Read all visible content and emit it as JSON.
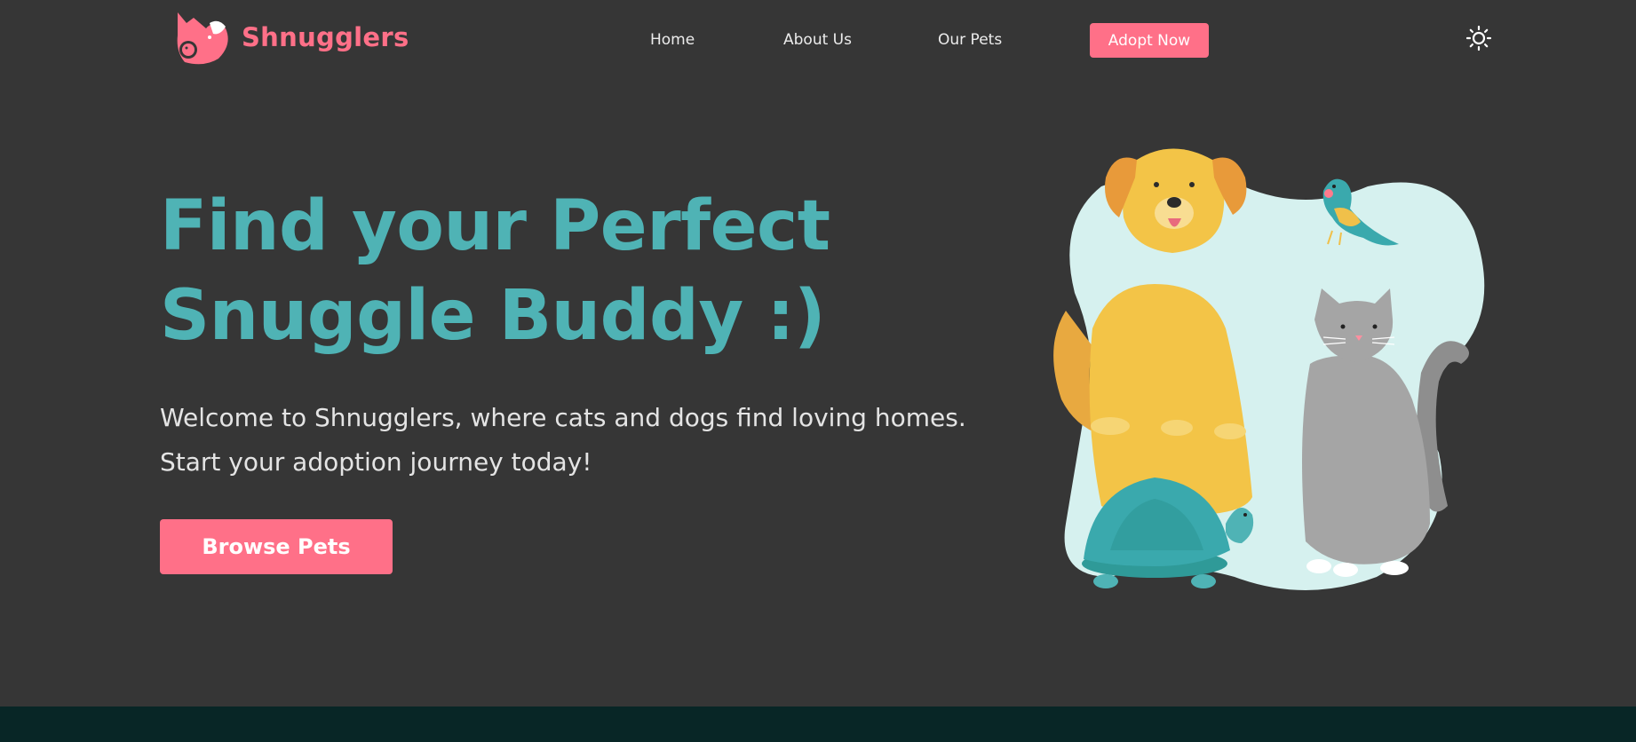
{
  "brand": {
    "name": "Shnugglers",
    "logo_icon": "cat-dog-logo-icon"
  },
  "nav": {
    "items": [
      {
        "label": "Home"
      },
      {
        "label": "About Us"
      },
      {
        "label": "Our Pets"
      }
    ],
    "cta_label": "Adopt Now",
    "theme_icon": "sun-icon"
  },
  "hero": {
    "title_line1": "Find your Perfect",
    "title_line2": "Snuggle Buddy :)",
    "subtitle_line1": "Welcome to Shnugglers, where cats and dogs find loving homes.",
    "subtitle_line2": "Start your adoption journey today!",
    "button_label": "Browse Pets",
    "illustration": "pets-illustration"
  },
  "colors": {
    "background": "#363636",
    "accent_pink": "#ff7088",
    "accent_teal": "#4fb3b5",
    "footer": "#082626"
  }
}
